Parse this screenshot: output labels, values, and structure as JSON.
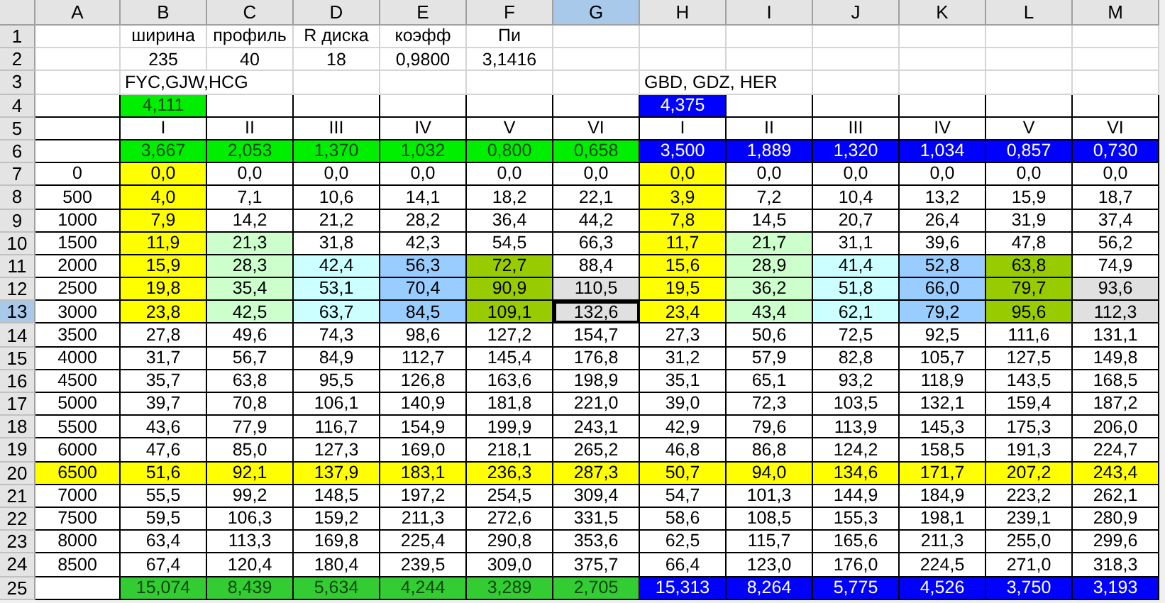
{
  "columns": [
    {
      "label": "A",
      "selected": false
    },
    {
      "label": "B",
      "selected": false
    },
    {
      "label": "C",
      "selected": false
    },
    {
      "label": "D",
      "selected": false
    },
    {
      "label": "E",
      "selected": false
    },
    {
      "label": "F",
      "selected": false
    },
    {
      "label": "G",
      "selected": true
    },
    {
      "label": "H",
      "selected": false
    },
    {
      "label": "I",
      "selected": false
    },
    {
      "label": "J",
      "selected": false
    },
    {
      "label": "K",
      "selected": false
    },
    {
      "label": "L",
      "selected": false
    },
    {
      "label": "M",
      "selected": false
    }
  ],
  "rows": [
    {
      "number": "1",
      "selected": false,
      "cells": [
        {},
        {
          "text": "ширина"
        },
        {
          "text": "профиль"
        },
        {
          "text": "R диска"
        },
        {
          "text": "коэфф"
        },
        {
          "text": "Пи"
        },
        {},
        {},
        {},
        {},
        {},
        {},
        {}
      ]
    },
    {
      "number": "2",
      "selected": false,
      "cells": [
        {},
        {
          "text": "235"
        },
        {
          "text": "40"
        },
        {
          "text": "18"
        },
        {
          "text": "0,9800"
        },
        {
          "text": "3,1416"
        },
        {},
        {},
        {},
        {},
        {},
        {},
        {}
      ]
    },
    {
      "number": "3",
      "selected": false,
      "cells": [
        {},
        {
          "text": "FYC,GJW,HCG",
          "kind": "note"
        },
        {},
        {},
        {},
        {},
        {},
        {
          "text": "GBD, GDZ, HER",
          "kind": "note"
        },
        {},
        {},
        {},
        {},
        {}
      ]
    },
    {
      "number": "4",
      "selected": false,
      "cells": [
        {},
        {
          "text": "4,111",
          "color": "#00ee00"
        },
        {},
        {},
        {},
        {},
        {},
        {
          "text": "4,375",
          "color": "#0000ff"
        },
        {},
        {},
        {},
        {},
        {}
      ]
    },
    {
      "number": "5",
      "selected": false,
      "cells": [
        {},
        {
          "text": "I"
        },
        {
          "text": "II"
        },
        {
          "text": "III"
        },
        {
          "text": "IV"
        },
        {
          "text": "V"
        },
        {
          "text": "VI"
        },
        {
          "text": "I"
        },
        {
          "text": "II"
        },
        {
          "text": "III"
        },
        {
          "text": "IV"
        },
        {
          "text": "V"
        },
        {
          "text": "VI"
        }
      ]
    },
    {
      "number": "6",
      "selected": false,
      "cells": [
        {},
        {
          "text": "3,667",
          "color": "#00ee00"
        },
        {
          "text": "2,053",
          "color": "#00ee00"
        },
        {
          "text": "1,370",
          "color": "#00ee00"
        },
        {
          "text": "1,032",
          "color": "#00ee00"
        },
        {
          "text": "0,800",
          "color": "#00ee00"
        },
        {
          "text": "0,658",
          "color": "#00ee00"
        },
        {
          "text": "3,500",
          "color": "#0000ff"
        },
        {
          "text": "1,889",
          "color": "#0000ff"
        },
        {
          "text": "1,320",
          "color": "#0000ff"
        },
        {
          "text": "1,034",
          "color": "#0000ff"
        },
        {
          "text": "0,857",
          "color": "#0000ff"
        },
        {
          "text": "0,730",
          "color": "#0000ff"
        }
      ]
    },
    {
      "number": "7",
      "selected": false,
      "cells": [
        {
          "text": "0"
        },
        {
          "text": "0,0",
          "color": "#ffff00"
        },
        {
          "text": "0,0"
        },
        {
          "text": "0,0"
        },
        {
          "text": "0,0"
        },
        {
          "text": "0,0"
        },
        {
          "text": "0,0"
        },
        {
          "text": "0,0",
          "color": "#ffff00"
        },
        {
          "text": "0,0"
        },
        {
          "text": "0,0"
        },
        {
          "text": "0,0"
        },
        {
          "text": "0,0"
        },
        {
          "text": "0,0"
        }
      ]
    },
    {
      "number": "8",
      "selected": false,
      "cells": [
        {
          "text": "500"
        },
        {
          "text": "4,0",
          "color": "#ffff00"
        },
        {
          "text": "7,1"
        },
        {
          "text": "10,6"
        },
        {
          "text": "14,1"
        },
        {
          "text": "18,2"
        },
        {
          "text": "22,1"
        },
        {
          "text": "3,9",
          "color": "#ffff00"
        },
        {
          "text": "7,2"
        },
        {
          "text": "10,4"
        },
        {
          "text": "13,2"
        },
        {
          "text": "15,9"
        },
        {
          "text": "18,7"
        }
      ]
    },
    {
      "number": "9",
      "selected": false,
      "cells": [
        {
          "text": "1000"
        },
        {
          "text": "7,9",
          "color": "#ffff00"
        },
        {
          "text": "14,2"
        },
        {
          "text": "21,2"
        },
        {
          "text": "28,2"
        },
        {
          "text": "36,4"
        },
        {
          "text": "44,2"
        },
        {
          "text": "7,8",
          "color": "#ffff00"
        },
        {
          "text": "14,5"
        },
        {
          "text": "20,7"
        },
        {
          "text": "26,4"
        },
        {
          "text": "31,9"
        },
        {
          "text": "37,4"
        }
      ]
    },
    {
      "number": "10",
      "selected": false,
      "cells": [
        {
          "text": "1500"
        },
        {
          "text": "11,9",
          "color": "#ffff00"
        },
        {
          "text": "21,3",
          "color": "#ccffcc"
        },
        {
          "text": "31,8"
        },
        {
          "text": "42,3"
        },
        {
          "text": "54,5"
        },
        {
          "text": "66,3"
        },
        {
          "text": "11,7",
          "color": "#ffff00"
        },
        {
          "text": "21,7",
          "color": "#ccffcc"
        },
        {
          "text": "31,1"
        },
        {
          "text": "39,6"
        },
        {
          "text": "47,8"
        },
        {
          "text": "56,2"
        }
      ]
    },
    {
      "number": "11",
      "selected": false,
      "cells": [
        {
          "text": "2000"
        },
        {
          "text": "15,9",
          "color": "#ffff00"
        },
        {
          "text": "28,3",
          "color": "#ccffcc"
        },
        {
          "text": "42,4",
          "color": "#ccffff"
        },
        {
          "text": "56,3",
          "color": "#99ccff"
        },
        {
          "text": "72,7",
          "color": "#99cc00"
        },
        {
          "text": "88,4"
        },
        {
          "text": "15,6",
          "color": "#ffff00"
        },
        {
          "text": "28,9",
          "color": "#ccffcc"
        },
        {
          "text": "41,4",
          "color": "#ccffff"
        },
        {
          "text": "52,8",
          "color": "#99ccff"
        },
        {
          "text": "63,8",
          "color": "#99cc00"
        },
        {
          "text": "74,9"
        }
      ]
    },
    {
      "number": "12",
      "selected": false,
      "cells": [
        {
          "text": "2500"
        },
        {
          "text": "19,8",
          "color": "#ffff00"
        },
        {
          "text": "35,4",
          "color": "#ccffcc"
        },
        {
          "text": "53,1",
          "color": "#ccffff"
        },
        {
          "text": "70,4",
          "color": "#99ccff"
        },
        {
          "text": "90,9",
          "color": "#99cc00"
        },
        {
          "text": "110,5",
          "color": "#e0e0e0"
        },
        {
          "text": "19,5",
          "color": "#ffff00"
        },
        {
          "text": "36,2",
          "color": "#ccffcc"
        },
        {
          "text": "51,8",
          "color": "#ccffff"
        },
        {
          "text": "66,0",
          "color": "#99ccff"
        },
        {
          "text": "79,7",
          "color": "#99cc00"
        },
        {
          "text": "93,6",
          "color": "#e0e0e0"
        }
      ]
    },
    {
      "number": "13",
      "selected": true,
      "cells": [
        {
          "text": "3000"
        },
        {
          "text": "23,8",
          "color": "#ffff00"
        },
        {
          "text": "42,5",
          "color": "#ccffcc"
        },
        {
          "text": "63,7",
          "color": "#ccffff"
        },
        {
          "text": "84,5",
          "color": "#99ccff"
        },
        {
          "text": "109,1",
          "color": "#99cc00"
        },
        {
          "text": "132,6",
          "color": "#e0e0e0"
        },
        {
          "text": "23,4",
          "color": "#ffff00"
        },
        {
          "text": "43,4",
          "color": "#ccffcc"
        },
        {
          "text": "62,1",
          "color": "#ccffff"
        },
        {
          "text": "79,2",
          "color": "#99ccff"
        },
        {
          "text": "95,6",
          "color": "#99cc00"
        },
        {
          "text": "112,3",
          "color": "#e0e0e0"
        }
      ]
    },
    {
      "number": "14",
      "selected": false,
      "cells": [
        {
          "text": "3500"
        },
        {
          "text": "27,8"
        },
        {
          "text": "49,6"
        },
        {
          "text": "74,3"
        },
        {
          "text": "98,6"
        },
        {
          "text": "127,2"
        },
        {
          "text": "154,7"
        },
        {
          "text": "27,3"
        },
        {
          "text": "50,6"
        },
        {
          "text": "72,5"
        },
        {
          "text": "92,5"
        },
        {
          "text": "111,6"
        },
        {
          "text": "131,1"
        }
      ]
    },
    {
      "number": "15",
      "selected": false,
      "cells": [
        {
          "text": "4000"
        },
        {
          "text": "31,7"
        },
        {
          "text": "56,7"
        },
        {
          "text": "84,9"
        },
        {
          "text": "112,7"
        },
        {
          "text": "145,4"
        },
        {
          "text": "176,8"
        },
        {
          "text": "31,2"
        },
        {
          "text": "57,9"
        },
        {
          "text": "82,8"
        },
        {
          "text": "105,7"
        },
        {
          "text": "127,5"
        },
        {
          "text": "149,8"
        }
      ]
    },
    {
      "number": "16",
      "selected": false,
      "cells": [
        {
          "text": "4500"
        },
        {
          "text": "35,7"
        },
        {
          "text": "63,8"
        },
        {
          "text": "95,5"
        },
        {
          "text": "126,8"
        },
        {
          "text": "163,6"
        },
        {
          "text": "198,9"
        },
        {
          "text": "35,1"
        },
        {
          "text": "65,1"
        },
        {
          "text": "93,2"
        },
        {
          "text": "118,9"
        },
        {
          "text": "143,5"
        },
        {
          "text": "168,5"
        }
      ]
    },
    {
      "number": "17",
      "selected": false,
      "cells": [
        {
          "text": "5000"
        },
        {
          "text": "39,7"
        },
        {
          "text": "70,8"
        },
        {
          "text": "106,1"
        },
        {
          "text": "140,9"
        },
        {
          "text": "181,8"
        },
        {
          "text": "221,0"
        },
        {
          "text": "39,0"
        },
        {
          "text": "72,3"
        },
        {
          "text": "103,5"
        },
        {
          "text": "132,1"
        },
        {
          "text": "159,4"
        },
        {
          "text": "187,2"
        }
      ]
    },
    {
      "number": "18",
      "selected": false,
      "cells": [
        {
          "text": "5500"
        },
        {
          "text": "43,6"
        },
        {
          "text": "77,9"
        },
        {
          "text": "116,7"
        },
        {
          "text": "154,9"
        },
        {
          "text": "199,9"
        },
        {
          "text": "243,1"
        },
        {
          "text": "42,9"
        },
        {
          "text": "79,6"
        },
        {
          "text": "113,9"
        },
        {
          "text": "145,3"
        },
        {
          "text": "175,3"
        },
        {
          "text": "206,0"
        }
      ]
    },
    {
      "number": "19",
      "selected": false,
      "cells": [
        {
          "text": "6000"
        },
        {
          "text": "47,6"
        },
        {
          "text": "85,0"
        },
        {
          "text": "127,3"
        },
        {
          "text": "169,0"
        },
        {
          "text": "218,1"
        },
        {
          "text": "265,2"
        },
        {
          "text": "46,8"
        },
        {
          "text": "86,8"
        },
        {
          "text": "124,2"
        },
        {
          "text": "158,5"
        },
        {
          "text": "191,3"
        },
        {
          "text": "224,7"
        }
      ]
    },
    {
      "number": "20",
      "selected": false,
      "cells": [
        {
          "text": "6500",
          "color": "#ffff00"
        },
        {
          "text": "51,6",
          "color": "#ffff00"
        },
        {
          "text": "92,1",
          "color": "#ffff00"
        },
        {
          "text": "137,9",
          "color": "#ffff00"
        },
        {
          "text": "183,1",
          "color": "#ffff00"
        },
        {
          "text": "236,3",
          "color": "#ffff00"
        },
        {
          "text": "287,3",
          "color": "#ffff00"
        },
        {
          "text": "50,7",
          "color": "#ffff00"
        },
        {
          "text": "94,0",
          "color": "#ffff00"
        },
        {
          "text": "134,6",
          "color": "#ffff00"
        },
        {
          "text": "171,7",
          "color": "#ffff00"
        },
        {
          "text": "207,2",
          "color": "#ffff00"
        },
        {
          "text": "243,4",
          "color": "#ffff00"
        }
      ]
    },
    {
      "number": "21",
      "selected": false,
      "cells": [
        {
          "text": "7000"
        },
        {
          "text": "55,5"
        },
        {
          "text": "99,2"
        },
        {
          "text": "148,5"
        },
        {
          "text": "197,2"
        },
        {
          "text": "254,5"
        },
        {
          "text": "309,4"
        },
        {
          "text": "54,7"
        },
        {
          "text": "101,3"
        },
        {
          "text": "144,9"
        },
        {
          "text": "184,9"
        },
        {
          "text": "223,2"
        },
        {
          "text": "262,1"
        }
      ]
    },
    {
      "number": "22",
      "selected": false,
      "cells": [
        {
          "text": "7500"
        },
        {
          "text": "59,5"
        },
        {
          "text": "106,3"
        },
        {
          "text": "159,2"
        },
        {
          "text": "211,3"
        },
        {
          "text": "272,6"
        },
        {
          "text": "331,5"
        },
        {
          "text": "58,6"
        },
        {
          "text": "108,5"
        },
        {
          "text": "155,3"
        },
        {
          "text": "198,1"
        },
        {
          "text": "239,1"
        },
        {
          "text": "280,9"
        }
      ]
    },
    {
      "number": "23",
      "selected": false,
      "cells": [
        {
          "text": "8000"
        },
        {
          "text": "63,4"
        },
        {
          "text": "113,3"
        },
        {
          "text": "169,8"
        },
        {
          "text": "225,4"
        },
        {
          "text": "290,8"
        },
        {
          "text": "353,6"
        },
        {
          "text": "62,5"
        },
        {
          "text": "115,7"
        },
        {
          "text": "165,6"
        },
        {
          "text": "211,3"
        },
        {
          "text": "255,0"
        },
        {
          "text": "299,6"
        }
      ]
    },
    {
      "number": "24",
      "selected": false,
      "cells": [
        {
          "text": "8500"
        },
        {
          "text": "67,4"
        },
        {
          "text": "120,4"
        },
        {
          "text": "180,4"
        },
        {
          "text": "239,5"
        },
        {
          "text": "309,0"
        },
        {
          "text": "375,7"
        },
        {
          "text": "66,4"
        },
        {
          "text": "123,0"
        },
        {
          "text": "176,0"
        },
        {
          "text": "224,5"
        },
        {
          "text": "271,0"
        },
        {
          "text": "318,3"
        }
      ]
    },
    {
      "number": "25",
      "selected": false,
      "cells": [
        {},
        {
          "text": "15,074",
          "color": "#33cc33"
        },
        {
          "text": "8,439",
          "color": "#33cc33"
        },
        {
          "text": "5,634",
          "color": "#33cc33"
        },
        {
          "text": "4,244",
          "color": "#33cc33"
        },
        {
          "text": "3,289",
          "color": "#33cc33"
        },
        {
          "text": "2,705",
          "color": "#33cc33"
        },
        {
          "text": "15,313",
          "color": "#0000ff"
        },
        {
          "text": "8,264",
          "color": "#0000ff"
        },
        {
          "text": "5,775",
          "color": "#0000ff"
        },
        {
          "text": "4,526",
          "color": "#0000ff"
        },
        {
          "text": "3,750",
          "color": "#0000ff"
        },
        {
          "text": "3,193",
          "color": "#0000ff"
        }
      ]
    }
  ]
}
